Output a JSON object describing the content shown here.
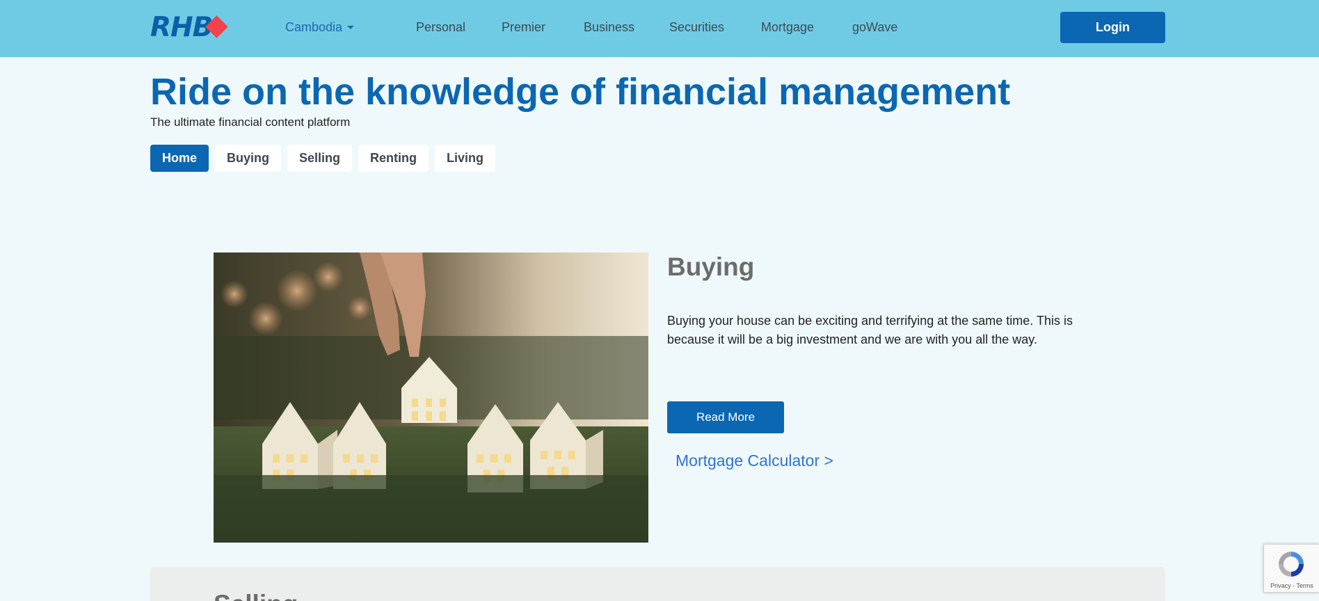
{
  "header": {
    "logo_text": "RHB",
    "country": "Cambodia",
    "nav": [
      "Personal",
      "Premier",
      "Business",
      "Securities",
      "Mortgage",
      "goWave"
    ],
    "login_label": "Login",
    "colors": {
      "bar": "#6fcbe3",
      "brand_blue": "#0b67b2",
      "logo_red": "#f2424b"
    }
  },
  "hero": {
    "title": "Ride on the knowledge of financial management",
    "subtitle": "The ultimate financial content platform"
  },
  "tabs": [
    "Home",
    "Buying",
    "Selling",
    "Renting",
    "Living"
  ],
  "active_tab": "Home",
  "feature": {
    "image": "paper-house-models-on-grass-photo",
    "title": "Buying",
    "description": "Buying your house can be exciting and terrifying at the same time. This is because it will be a big investment and we are with you all the way.",
    "read_more": "Read More",
    "calculator_link": "Mortgage Calculator >"
  },
  "next_section": {
    "title": "Selling"
  },
  "recaptcha": {
    "links": "Privacy - Terms"
  }
}
